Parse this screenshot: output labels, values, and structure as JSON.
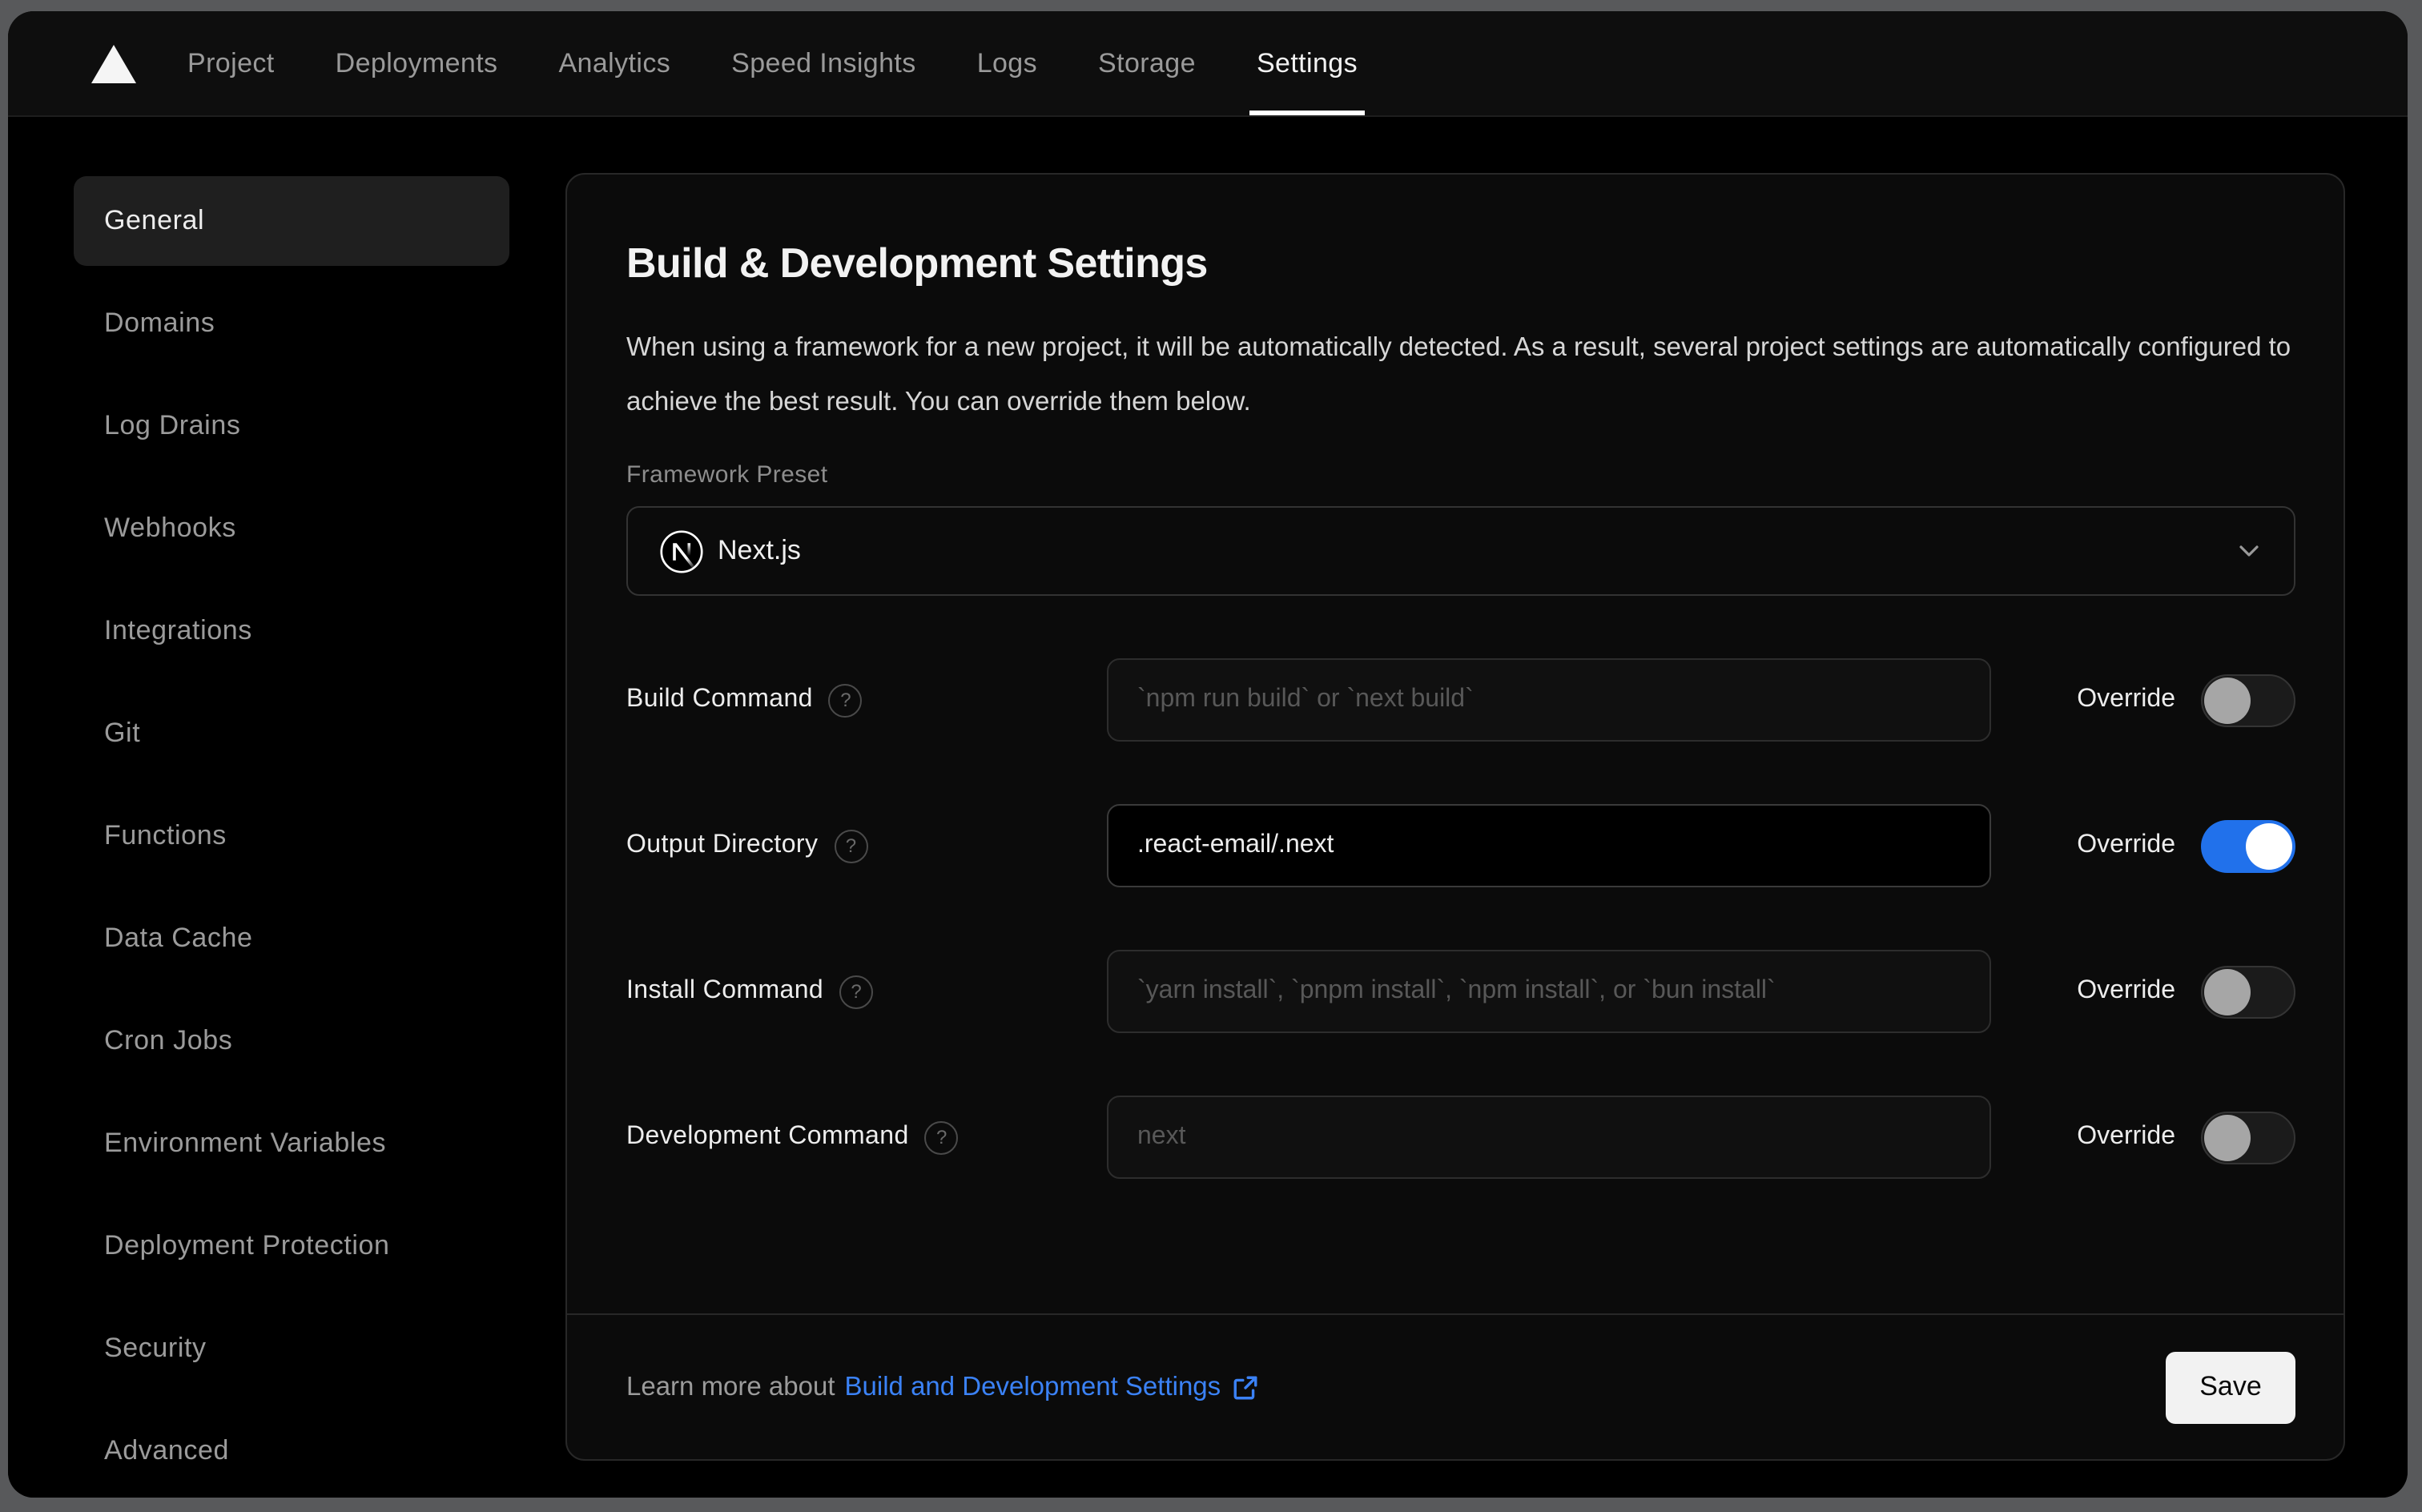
{
  "nav": {
    "logo": "vercel-triangle-logo",
    "tabs": [
      {
        "label": "Project",
        "active": false
      },
      {
        "label": "Deployments",
        "active": false
      },
      {
        "label": "Analytics",
        "active": false
      },
      {
        "label": "Speed Insights",
        "active": false
      },
      {
        "label": "Logs",
        "active": false
      },
      {
        "label": "Storage",
        "active": false
      },
      {
        "label": "Settings",
        "active": true
      }
    ]
  },
  "sidebar": {
    "items": [
      {
        "label": "General",
        "active": true
      },
      {
        "label": "Domains",
        "active": false
      },
      {
        "label": "Log Drains",
        "active": false
      },
      {
        "label": "Webhooks",
        "active": false
      },
      {
        "label": "Integrations",
        "active": false
      },
      {
        "label": "Git",
        "active": false
      },
      {
        "label": "Functions",
        "active": false
      },
      {
        "label": "Data Cache",
        "active": false
      },
      {
        "label": "Cron Jobs",
        "active": false
      },
      {
        "label": "Environment Variables",
        "active": false
      },
      {
        "label": "Deployment Protection",
        "active": false
      },
      {
        "label": "Security",
        "active": false
      },
      {
        "label": "Advanced",
        "active": false
      }
    ]
  },
  "main": {
    "title": "Build & Development Settings",
    "description": "When using a framework for a new project, it will be automatically detected. As a result, several project settings are automatically configured to achieve the best result. You can override them below.",
    "framework": {
      "label": "Framework Preset",
      "value": "Next.js",
      "icon": "nextjs-logo"
    },
    "override_label": "Override",
    "rows": [
      {
        "label": "Build Command",
        "placeholder": "`npm run build` or `next build`",
        "value": "",
        "override": false
      },
      {
        "label": "Output Directory",
        "placeholder": "",
        "value": ".react-email/.next",
        "override": true
      },
      {
        "label": "Install Command",
        "placeholder": "`yarn install`, `pnpm install`, `npm install`, or `bun install`",
        "value": "",
        "override": false
      },
      {
        "label": "Development Command",
        "placeholder": "next",
        "value": "",
        "override": false
      }
    ],
    "footer": {
      "text": "Learn more about",
      "link_label": "Build and Development Settings",
      "save_label": "Save"
    }
  },
  "colors": {
    "accent_blue_toggle": "#2171eb",
    "link_blue": "#3b82f6",
    "window_bg": "#000000",
    "card_bg": "#0b0b0b",
    "desktop_bg": "#58595b"
  }
}
